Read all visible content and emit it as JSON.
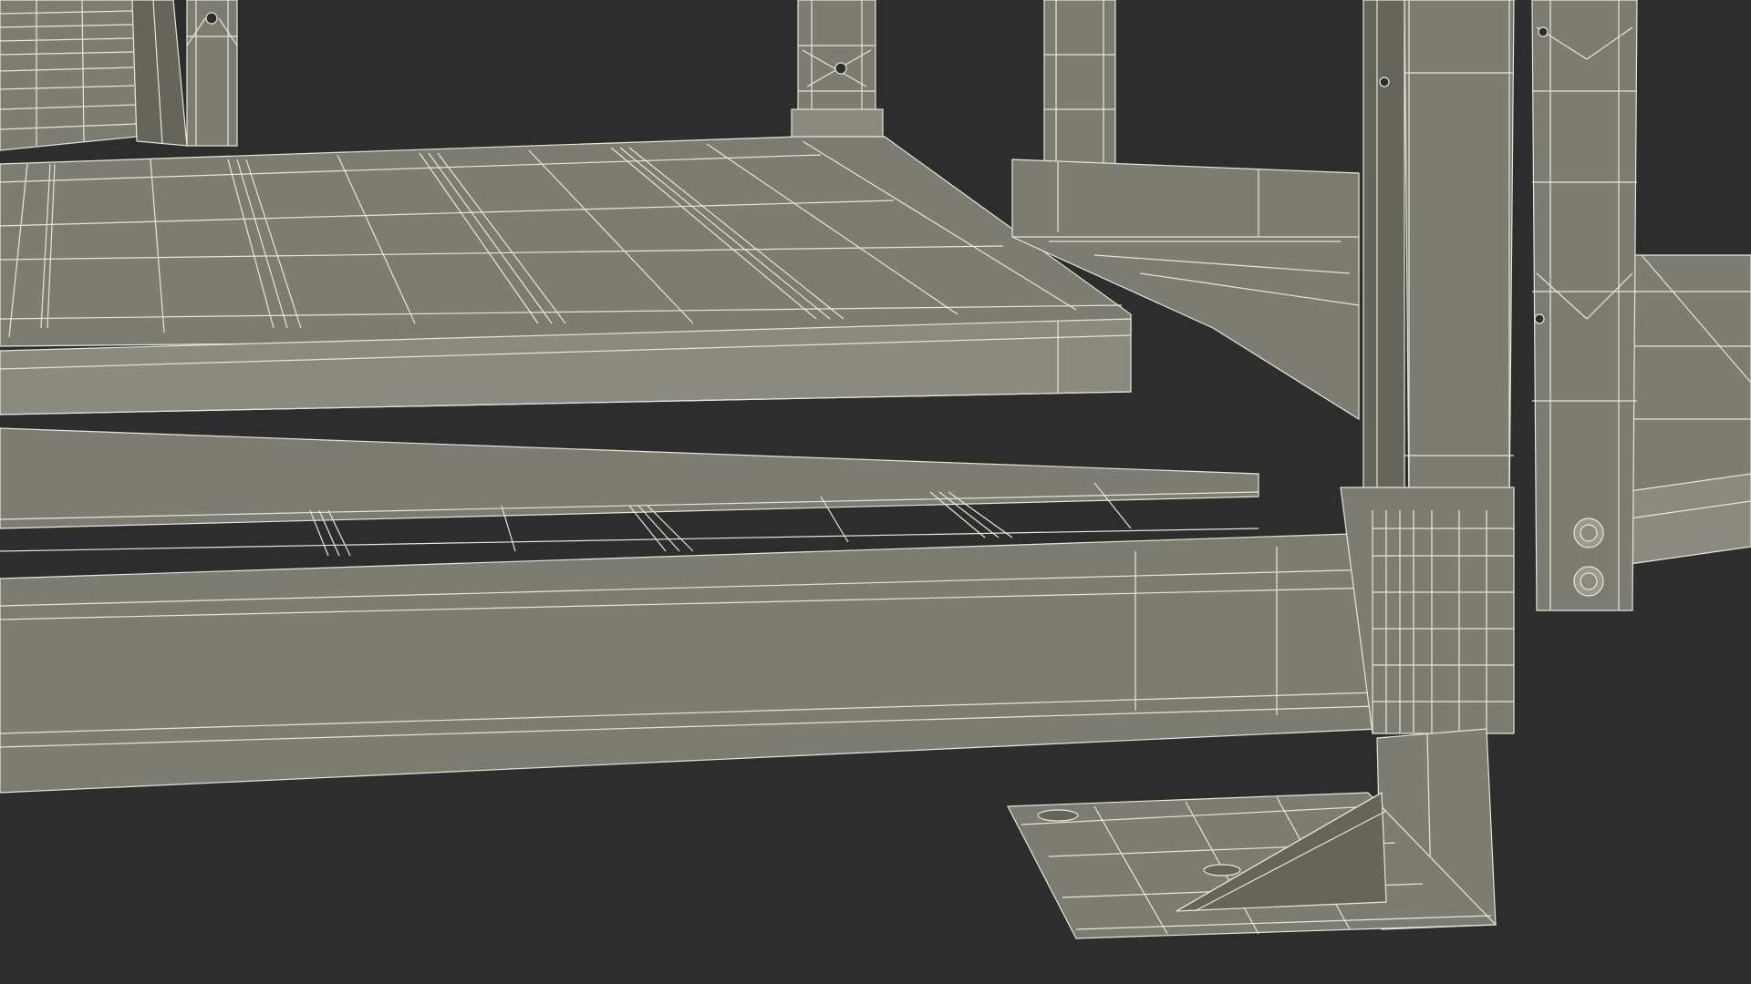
{
  "scene": {
    "subject": "wireframe-render",
    "colors": {
      "background": "#2d2d2d",
      "surface": "#7c7c72",
      "surface_light": "#8a8a80",
      "surface_dark": "#65655c",
      "wire": "#e6e6d8",
      "bolt": "#9a9a90"
    }
  }
}
